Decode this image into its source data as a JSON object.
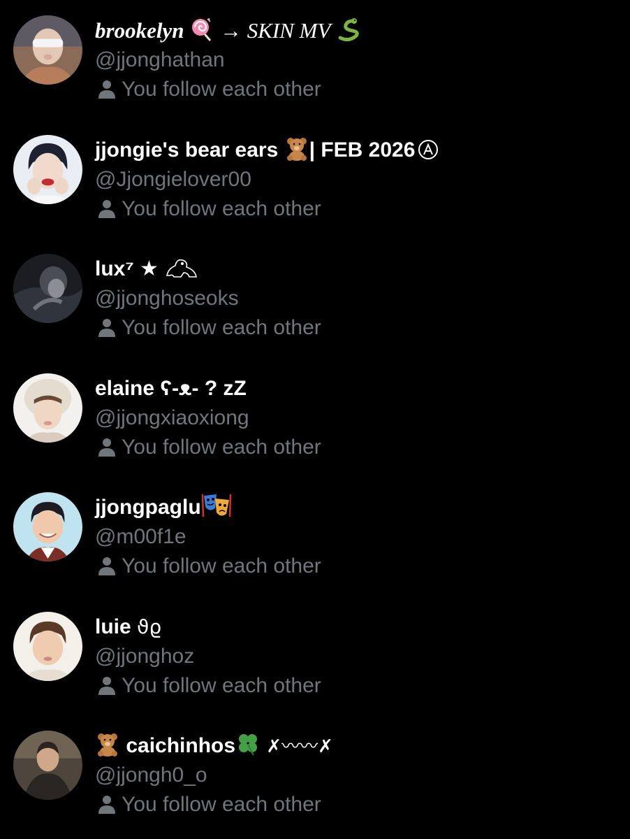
{
  "follow_status": "You follow each other",
  "colors": {
    "background": "#000000",
    "name": "#ffffff",
    "secondary": "#71767b"
  },
  "users": [
    {
      "name_before": "brookelyn",
      "name_after": " → SKIN MV ",
      "handle": "@jjonghathan",
      "emoji_1": "lollipop-emoji",
      "emoji_2": "snake-emoji"
    },
    {
      "name_before": "jjongie's bear ears ",
      "name_after": "| FEB 2026",
      "handle": "@Jjongielover00",
      "emoji_1": "teddy-bear-emoji",
      "badge": "circled-a-icon"
    },
    {
      "name_before": "lux⁷ ★ ",
      "handle": "@jjonghoseoks",
      "emoji_1": "frog-outline-emoji"
    },
    {
      "name_before": "elaine ʕ-ᴥ- ? zZ",
      "handle": "@jjongxiaoxiong"
    },
    {
      "name_before": "jjongpaglu",
      "handle": "@m00f1e",
      "emoji_1": "performing-arts-emoji"
    },
    {
      "name_before": "luie ",
      "name_symbols": "ϑϱ",
      "handle": "@jjonghoz"
    },
    {
      "name_before": "caichinhos",
      "name_after": " ✗〰〰✗",
      "handle": "@jjongh0_o",
      "emoji_1": "teddy-bear-emoji",
      "emoji_2": "four-leaf-clover-emoji"
    }
  ]
}
